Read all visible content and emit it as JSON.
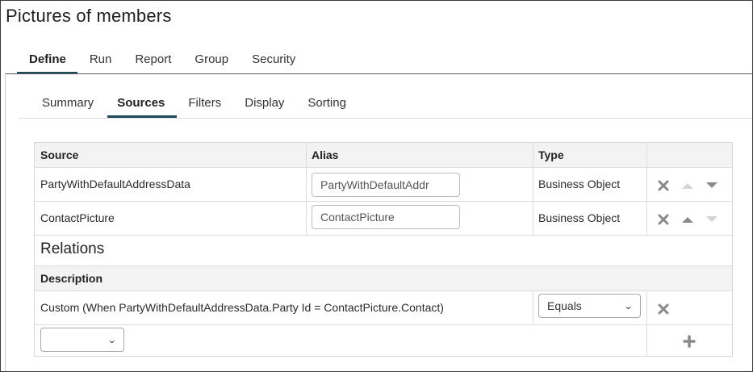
{
  "page": {
    "title": "Pictures of members"
  },
  "top_tabs": [
    {
      "label": "Define",
      "active": true
    },
    {
      "label": "Run",
      "active": false
    },
    {
      "label": "Report",
      "active": false
    },
    {
      "label": "Group",
      "active": false
    },
    {
      "label": "Security",
      "active": false
    }
  ],
  "sub_tabs": [
    {
      "label": "Summary",
      "active": false
    },
    {
      "label": "Sources",
      "active": true
    },
    {
      "label": "Filters",
      "active": false
    },
    {
      "label": "Display",
      "active": false
    },
    {
      "label": "Sorting",
      "active": false
    }
  ],
  "sources": {
    "headers": {
      "source": "Source",
      "alias": "Alias",
      "type": "Type"
    },
    "rows": [
      {
        "source": "PartyWithDefaultAddressData",
        "alias": "PartyWithDefaultAddr",
        "type": "Business Object"
      },
      {
        "source": "ContactPicture",
        "alias": "ContactPicture",
        "type": "Business Object"
      }
    ]
  },
  "relations": {
    "title": "Relations",
    "header_description": "Description",
    "rows": [
      {
        "description": "Custom (When PartyWithDefaultAddressData.Party Id = ContactPicture.Contact)",
        "operator": "Equals"
      }
    ],
    "new_row_select": ""
  },
  "icons": {
    "remove": "close-x-icon",
    "move_up": "caret-up-icon",
    "move_down": "caret-down-icon",
    "add": "plus-icon"
  },
  "colors": {
    "accent": "#1e4a5c",
    "icon": "#8a8a8a",
    "icon_disabled": "#d4d4d4"
  }
}
